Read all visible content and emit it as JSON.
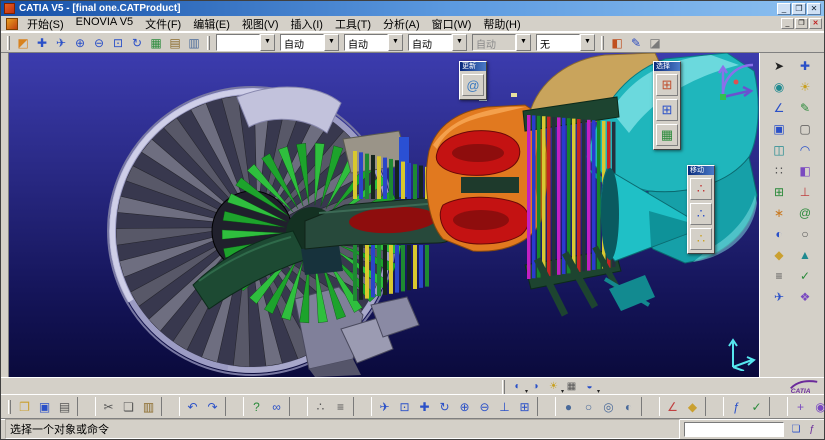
{
  "window": {
    "title": "CATIA V5 - [final one.CATProduct]"
  },
  "titlebar": {
    "buttons": [
      {
        "name": "minimize-button",
        "glyph": "_"
      },
      {
        "name": "maximize-button",
        "glyph": "❐"
      },
      {
        "name": "close-button",
        "glyph": "✕"
      }
    ]
  },
  "menubar": {
    "items": [
      "开始(S)",
      "ENOVIA V5",
      "文件(F)",
      "编辑(E)",
      "视图(V)",
      "插入(I)",
      "工具(T)",
      "分析(A)",
      "窗口(W)",
      "帮助(H)"
    ],
    "window_buttons": [
      {
        "name": "doc-minimize-button",
        "glyph": "_"
      },
      {
        "name": "doc-restore-button",
        "glyph": "❐"
      },
      {
        "name": "doc-close-button",
        "glyph": "✕",
        "kind": "close"
      }
    ]
  },
  "toolbar_top": {
    "combo_arrow": "▼",
    "icons": [
      {
        "name": "workbench-icon",
        "glyph": "◩",
        "color": "#d8821e"
      },
      {
        "name": "pan-icon",
        "glyph": "✚",
        "color": "#2a50c8"
      },
      {
        "name": "fly-mode-icon",
        "glyph": "✈",
        "color": "#2a50c8"
      },
      {
        "name": "zoom-in-icon",
        "glyph": "⊕",
        "color": "#2a50c8"
      },
      {
        "name": "zoom-out-icon",
        "glyph": "⊖",
        "color": "#2a50c8"
      },
      {
        "name": "fit-all-icon",
        "glyph": "⊡",
        "color": "#2a50c8"
      },
      {
        "name": "rotate-view-icon",
        "glyph": "↻",
        "color": "#2a50c8"
      },
      {
        "name": "grid-icon",
        "glyph": "▦",
        "color": "#2a8a3a"
      },
      {
        "name": "datasheet-icon",
        "glyph": "▤",
        "color": "#8a6a2a"
      },
      {
        "name": "catalog-icon",
        "glyph": "▥",
        "color": "#4a6a9a"
      }
    ],
    "combos": [
      {
        "name": "filter-combo",
        "value": ""
      },
      {
        "name": "linetype-combo",
        "value": "自动"
      },
      {
        "name": "thickness-combo",
        "value": "自动"
      },
      {
        "name": "color-combo",
        "value": "自动"
      },
      {
        "name": "layer-combo",
        "value": "自动",
        "state": "disabled"
      },
      {
        "name": "render-combo",
        "value": "无"
      }
    ],
    "icons_after": [
      {
        "name": "paint-icon",
        "glyph": "◧",
        "color": "#c05020"
      },
      {
        "name": "pen-icon",
        "glyph": "✎",
        "color": "#2a4ac0"
      },
      {
        "name": "wizard-icon",
        "glyph": "◪",
        "color": "#7a7a7a"
      }
    ]
  },
  "viewport": {
    "palettes": [
      {
        "title": "更新",
        "icons": [
          {
            "name": "update-icon",
            "glyph": "@",
            "color": "#3a7ac0"
          }
        ]
      },
      {
        "title": "选择",
        "icons": [
          {
            "name": "structure-filter-icon",
            "glyph": "⊞",
            "color": "#c05030"
          },
          {
            "name": "volume-filter-icon",
            "glyph": "⊞",
            "color": "#2a50c8"
          },
          {
            "name": "group-filter-icon",
            "glyph": "▦",
            "color": "#2a8a3a"
          }
        ]
      },
      {
        "title": "移动",
        "icons": [
          {
            "name": "manipulate-icon",
            "glyph": "∴",
            "color": "#c03030"
          },
          {
            "name": "snap-icon",
            "glyph": "∴",
            "color": "#2a50c8"
          },
          {
            "name": "smart-move-icon",
            "glyph": "∴",
            "color": "#caa020"
          }
        ]
      }
    ]
  },
  "right_toolbar": {
    "icons": [
      {
        "name": "select-icon",
        "glyph": "➤",
        "color": "#222222"
      },
      {
        "name": "pan-view-icon",
        "glyph": "✚",
        "color": "#2a50c8"
      },
      {
        "name": "camera-icon",
        "glyph": "◉",
        "color": "#1f8a90"
      },
      {
        "name": "light-icon",
        "glyph": "☀",
        "color": "#c8a020"
      },
      {
        "name": "measure-icon",
        "glyph": "∠",
        "color": "#2a50c8"
      },
      {
        "name": "sketcher-icon",
        "glyph": "✎",
        "color": "#2a8a3a"
      },
      {
        "name": "pad-icon",
        "glyph": "▣",
        "color": "#2a50c8"
      },
      {
        "name": "pocket-icon",
        "glyph": "▢",
        "color": "#555555"
      },
      {
        "name": "shell-icon",
        "glyph": "◫",
        "color": "#1f8a90"
      },
      {
        "name": "fillet-icon",
        "glyph": "◠",
        "color": "#2a50c8"
      },
      {
        "name": "pattern-icon",
        "glyph": "∷",
        "color": "#555555"
      },
      {
        "name": "mirror-icon",
        "glyph": "◧",
        "color": "#7a4ac0"
      },
      {
        "name": "assemble-icon",
        "glyph": "⊞",
        "color": "#2a8a3a"
      },
      {
        "name": "constraint-icon",
        "glyph": "⊥",
        "color": "#c04040"
      },
      {
        "name": "explode-icon",
        "glyph": "∗",
        "color": "#c87820"
      },
      {
        "name": "update-all-icon",
        "glyph": "@",
        "color": "#2a8a3a"
      },
      {
        "name": "shading-icon",
        "glyph": "◐",
        "color": "#2a50c8"
      },
      {
        "name": "wireframe-icon",
        "glyph": "○",
        "color": "#555555"
      },
      {
        "name": "material-icon",
        "glyph": "◆",
        "color": "#caa030"
      },
      {
        "name": "triad-icon",
        "glyph": "▲",
        "color": "#1f8a90"
      },
      {
        "name": "tree-icon",
        "glyph": "≡",
        "color": "#555555"
      },
      {
        "name": "verify-icon",
        "glyph": "✓",
        "color": "#2a8a3a"
      },
      {
        "name": "fly-icon",
        "glyph": "✈",
        "color": "#2a50c8"
      },
      {
        "name": "section-icon",
        "glyph": "❖",
        "color": "#7a4ac0"
      }
    ]
  },
  "bottom_mini": {
    "icons": [
      {
        "name": "view-mode-icon",
        "glyph": "◐",
        "color": "#2a50c8",
        "dd": "dd"
      },
      {
        "name": "render-style-icon",
        "glyph": "◑",
        "color": "#2a50c8"
      },
      {
        "name": "lighting-icon",
        "glyph": "☀",
        "color": "#c8a020",
        "dd": "dd"
      },
      {
        "name": "grid-snap-icon",
        "glyph": "▦",
        "color": "#555555"
      },
      {
        "name": "depth-effect-icon",
        "glyph": "◒",
        "color": "#2a50c8",
        "dd": "dd"
      }
    ]
  },
  "bottom_toolbar": {
    "logo_text": "CATIA",
    "icons": [
      {
        "name": "open-icon",
        "glyph": "❐",
        "color": "#caa030"
      },
      {
        "name": "save-icon",
        "glyph": "▣",
        "color": "#2a50c8"
      },
      {
        "name": "print-icon",
        "glyph": "▤",
        "color": "#555555"
      },
      {
        "name": "separator",
        "kind": "sep"
      },
      {
        "name": "cut-icon",
        "glyph": "✂",
        "color": "#555555"
      },
      {
        "name": "copy-icon",
        "glyph": "❏",
        "color": "#555555"
      },
      {
        "name": "paste-icon",
        "glyph": "▥",
        "color": "#8a6a2a"
      },
      {
        "name": "separator",
        "kind": "sep"
      },
      {
        "name": "undo-icon",
        "glyph": "↶",
        "color": "#2a50c8"
      },
      {
        "name": "redo-icon",
        "glyph": "↷",
        "color": "#2a50c8"
      },
      {
        "name": "separator",
        "kind": "sep"
      },
      {
        "name": "help-icon",
        "glyph": "?",
        "color": "#2a8a3a"
      },
      {
        "name": "link-icon",
        "glyph": "∞",
        "color": "#2a50c8"
      },
      {
        "name": "separator",
        "kind": "sep"
      },
      {
        "name": "spec-tree-icon",
        "glyph": "∴",
        "color": "#555555"
      },
      {
        "name": "graph-icon",
        "glyph": "≡",
        "color": "#555555"
      },
      {
        "name": "separator",
        "kind": "sep"
      },
      {
        "name": "fly-through-icon",
        "glyph": "✈",
        "color": "#2a50c8"
      },
      {
        "name": "fit-icon",
        "glyph": "⊡",
        "color": "#2a50c8"
      },
      {
        "name": "pan-tool-icon",
        "glyph": "✚",
        "color": "#2a50c8"
      },
      {
        "name": "rotate-tool-icon",
        "glyph": "↻",
        "color": "#2a50c8"
      },
      {
        "name": "zoomin-tool-icon",
        "glyph": "⊕",
        "color": "#2a50c8"
      },
      {
        "name": "zoomout-tool-icon",
        "glyph": "⊖",
        "color": "#2a50c8"
      },
      {
        "name": "normal-view-icon",
        "glyph": "⊥",
        "color": "#2a50c8"
      },
      {
        "name": "multi-view-icon",
        "glyph": "⊞",
        "color": "#2a50c8"
      },
      {
        "name": "separator",
        "kind": "sep"
      },
      {
        "name": "shaded-icon",
        "glyph": "●",
        "color": "#4a6a9a"
      },
      {
        "name": "wireframe-view-icon",
        "glyph": "○",
        "color": "#4a6a9a"
      },
      {
        "name": "hidden-line-icon",
        "glyph": "◎",
        "color": "#4a6a9a"
      },
      {
        "name": "swap-visible-icon",
        "glyph": "◐",
        "color": "#4a6a9a"
      },
      {
        "name": "separator",
        "kind": "sep"
      },
      {
        "name": "measure-between-icon",
        "glyph": "∠",
        "color": "#c04040"
      },
      {
        "name": "mass-icon",
        "glyph": "◆",
        "color": "#caa030"
      },
      {
        "name": "separator",
        "kind": "sep"
      },
      {
        "name": "formula-icon",
        "glyph": "ƒ",
        "color": "#2a50c8"
      },
      {
        "name": "check-icon",
        "glyph": "✓",
        "color": "#2a8a3a"
      },
      {
        "name": "separator",
        "kind": "sep"
      },
      {
        "name": "axis-system-icon",
        "glyph": "+",
        "color": "#7a4ac0"
      },
      {
        "name": "target-icon",
        "glyph": "◉",
        "color": "#7a4ac0"
      }
    ]
  },
  "statusbar": {
    "message": "选择一个对象或命令",
    "input_value": "",
    "icons": [
      {
        "name": "dialog-toggle-icon",
        "glyph": "❏",
        "color": "#2a50c8"
      },
      {
        "name": "power-input-icon",
        "glyph": "ƒ",
        "color": "#6a2a9a"
      }
    ]
  },
  "colors": {
    "fan_blade": "#6e6e80",
    "fan_blade_dark": "#585868",
    "fan_ring": "#9c9cc4",
    "booster": "#1da32c",
    "booster_light": "#2fbf3e",
    "spinner": "#1d4a33",
    "shaft": "#27493b",
    "compressor": [
      "#d8c82e",
      "#2a46c8",
      "#1e8a32",
      "#16251e"
    ],
    "combustor": "#e1791f",
    "combustor_light": "#f4a04c",
    "combustor_dark": "#b05a12",
    "flame": "#c41212",
    "flame_dark": "#8e0d0d",
    "turbine": [
      "#c220c2",
      "#2a3ad0",
      "#18872a",
      "#d8c832",
      "#c42424",
      "#24303e"
    ],
    "cowl": "#c9a45c",
    "nozzle": "#1fb6bc",
    "nozzle_light": "#85e4e8",
    "nozzle_dark": "#0c8a90"
  }
}
